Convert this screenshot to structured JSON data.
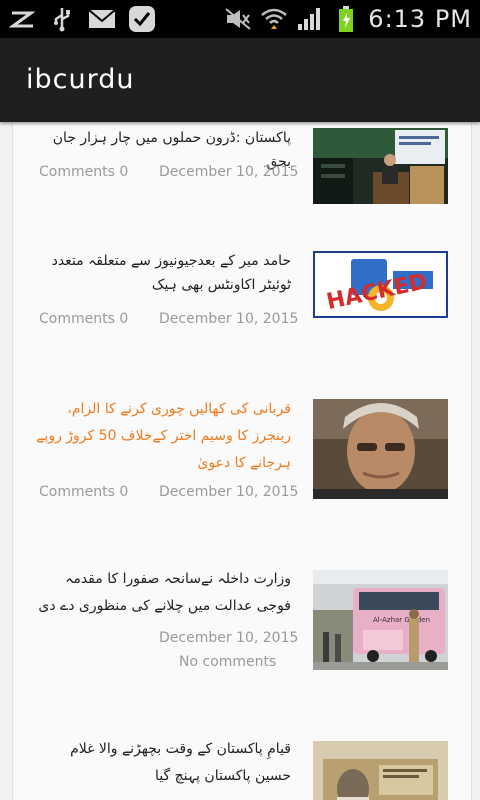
{
  "status_bar": {
    "time": "6:13 PM",
    "left_icons": [
      "z-notification-icon",
      "usb-icon",
      "mail-icon",
      "task-check-icon"
    ],
    "right_icons": [
      "mute-icon",
      "wifi-icon",
      "signal-icon",
      "battery-charging-icon"
    ]
  },
  "app_bar": {
    "title": "ibcurdu"
  },
  "articles": [
    {
      "title": "پاکستان :ڈرون حملوں میں چار ہزار جان بحق",
      "comments": "Comments 0",
      "date": "December 10, 2015",
      "image": "speaker-at-podium-photo"
    },
    {
      "title": "حامد میر کے بعدجیونیوز سے متعلقہ متعدد ٹوئیٹر اکاونٹس بھی ہیک",
      "comments": "Comments 0",
      "date": "December 10, 2015",
      "image": "hacked-logo-image",
      "image_text": "HACKED"
    },
    {
      "title": "قربانی کی کھالیں چوری کرنے کا الزام، رینجرز کا وسیم اختر کےخلاف 50 کروڑ روپے ہرجانے کا دعویٰ",
      "title_color": "#f07b1e",
      "comments": "Comments 0",
      "date": "December 10, 2015",
      "image": "man-portrait-photo"
    },
    {
      "title": "وزارت داخلہ نےسانحہ صفورا کا مقدمہ فوجی عدالت میں چلانے کی منظوری دے دی",
      "date": "December 10, 2015",
      "comments": "No comments",
      "image": "pink-bus-photo",
      "image_text": "Al-Azhar Garden"
    },
    {
      "title": "قیامِ پاکستان کے وقت بچھڑنے والا غلام حسین پاکستان پہنچ گیا",
      "image": "old-id-card-photo"
    }
  ]
}
